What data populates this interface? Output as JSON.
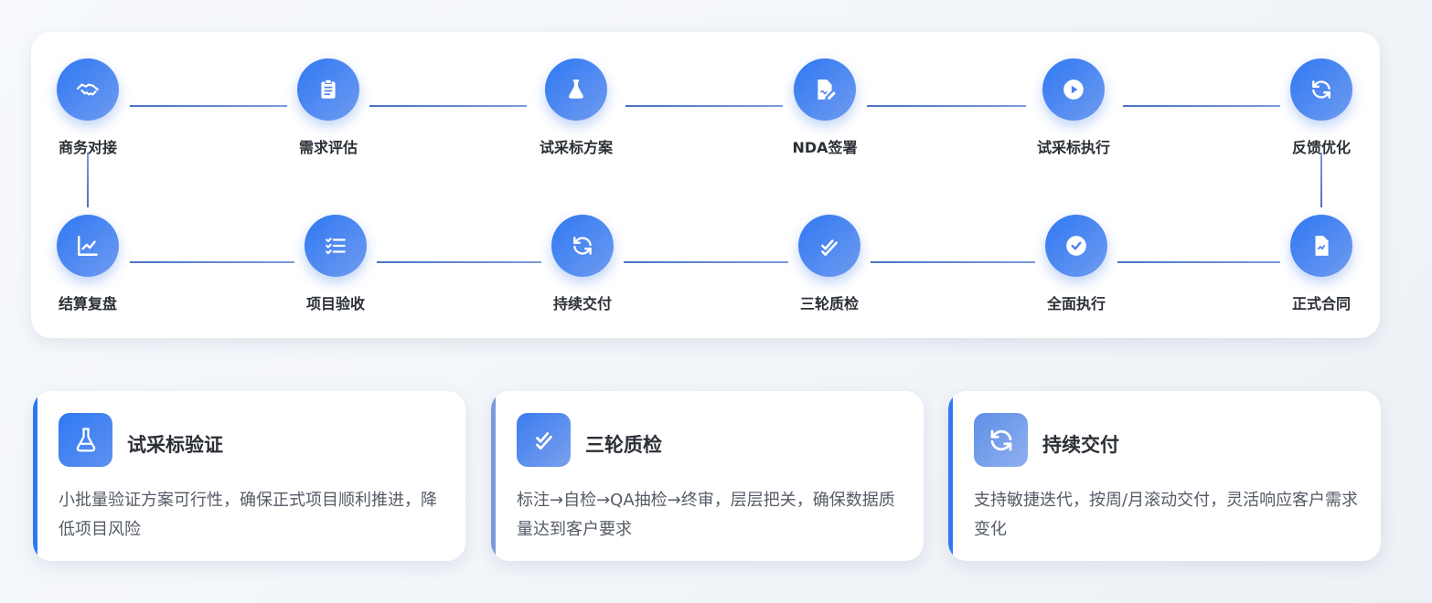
{
  "colors": {
    "accent": "#2f78f2",
    "accent_light": "#6f9bf0",
    "connector": "#4a72c4",
    "text": "#2b2f36",
    "muted_text": "#555b66"
  },
  "process": {
    "row1": [
      {
        "label": "商务对接",
        "icon": "handshake-icon"
      },
      {
        "label": "需求评估",
        "icon": "clipboard-list-icon"
      },
      {
        "label": "试采标方案",
        "icon": "flask-icon"
      },
      {
        "label": "NDA签署",
        "icon": "signature-icon"
      },
      {
        "label": "试采标执行",
        "icon": "play-circle-icon"
      },
      {
        "label": "反馈优化",
        "icon": "refresh-icon"
      }
    ],
    "row2": [
      {
        "label": "结算复盘",
        "icon": "chart-line-icon"
      },
      {
        "label": "项目验收",
        "icon": "list-check-icon"
      },
      {
        "label": "持续交付",
        "icon": "refresh-icon"
      },
      {
        "label": "三轮质检",
        "icon": "double-check-icon"
      },
      {
        "label": "全面执行",
        "icon": "check-circle-icon"
      },
      {
        "label": "正式合同",
        "icon": "contract-icon"
      }
    ]
  },
  "cards": [
    {
      "title": "试采标验证",
      "description": "小批量验证方案可行性，确保正式项目顺利推进，降低项目风险",
      "icon": "flask-icon"
    },
    {
      "title": "三轮质检",
      "description": "标注→自检→QA抽检→终审，层层把关，确保数据质量达到客户要求",
      "icon": "double-check-icon"
    },
    {
      "title": "持续交付",
      "description": "支持敏捷迭代，按周/月滚动交付，灵活响应客户需求变化",
      "icon": "refresh-icon"
    }
  ]
}
